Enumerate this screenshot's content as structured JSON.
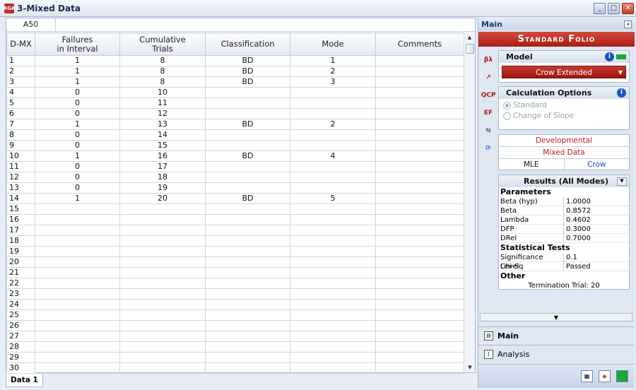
{
  "window": {
    "title": "3-Mixed Data"
  },
  "cellbar": {
    "ref": "A50"
  },
  "sheet": {
    "columns": [
      "D-MX",
      "Failures\nin Interval",
      "Cumulative\nTrials",
      "Classification",
      "Mode",
      "Comments"
    ],
    "rows": [
      [
        "1",
        "1",
        "8",
        "BD",
        "1",
        ""
      ],
      [
        "2",
        "1",
        "8",
        "BD",
        "2",
        ""
      ],
      [
        "3",
        "1",
        "8",
        "BD",
        "3",
        ""
      ],
      [
        "4",
        "0",
        "10",
        "",
        "",
        ""
      ],
      [
        "5",
        "0",
        "11",
        "",
        "",
        ""
      ],
      [
        "6",
        "0",
        "12",
        "",
        "",
        ""
      ],
      [
        "7",
        "1",
        "13",
        "BD",
        "2",
        ""
      ],
      [
        "8",
        "0",
        "14",
        "",
        "",
        ""
      ],
      [
        "9",
        "0",
        "15",
        "",
        "",
        ""
      ],
      [
        "10",
        "1",
        "16",
        "BD",
        "4",
        ""
      ],
      [
        "11",
        "0",
        "17",
        "",
        "",
        ""
      ],
      [
        "12",
        "0",
        "18",
        "",
        "",
        ""
      ],
      [
        "13",
        "0",
        "19",
        "",
        "",
        ""
      ],
      [
        "14",
        "1",
        "20",
        "BD",
        "5",
        ""
      ],
      [
        "15",
        "",
        "",
        "",
        "",
        ""
      ],
      [
        "16",
        "",
        "",
        "",
        "",
        ""
      ],
      [
        "17",
        "",
        "",
        "",
        "",
        ""
      ],
      [
        "18",
        "",
        "",
        "",
        "",
        ""
      ],
      [
        "19",
        "",
        "",
        "",
        "",
        ""
      ],
      [
        "20",
        "",
        "",
        "",
        "",
        ""
      ],
      [
        "21",
        "",
        "",
        "",
        "",
        ""
      ],
      [
        "22",
        "",
        "",
        "",
        "",
        ""
      ],
      [
        "23",
        "",
        "",
        "",
        "",
        ""
      ],
      [
        "24",
        "",
        "",
        "",
        "",
        ""
      ],
      [
        "25",
        "",
        "",
        "",
        "",
        ""
      ],
      [
        "26",
        "",
        "",
        "",
        "",
        ""
      ],
      [
        "27",
        "",
        "",
        "",
        "",
        ""
      ],
      [
        "28",
        "",
        "",
        "",
        "",
        ""
      ],
      [
        "29",
        "",
        "",
        "",
        "",
        ""
      ],
      [
        "30",
        "",
        "",
        "",
        "",
        ""
      ]
    ]
  },
  "tabs": {
    "sheet_tab": "Data 1"
  },
  "panel": {
    "header": "Main",
    "folio_title": "Standard Folio",
    "model": {
      "label": "Model",
      "selected": "Crow Extended"
    },
    "calc": {
      "label": "Calculation Options",
      "opt1": "Standard",
      "opt2": "Change of Slope"
    },
    "info": {
      "line1": "Developmental",
      "line2": "Mixed Data",
      "method": "MLE",
      "model": "Crow"
    },
    "results": {
      "header": "Results (All Modes)",
      "params_label": "Parameters",
      "params": [
        [
          "Beta (hyp)",
          "1.0000"
        ],
        [
          "Beta",
          "0.8572"
        ],
        [
          "Lambda",
          "0.4602"
        ],
        [
          "DFP",
          "0.3000"
        ],
        [
          "DRel",
          "0.7000"
        ]
      ],
      "tests_label": "Statistical Tests",
      "tests": [
        [
          "Significance Level",
          "0.1"
        ],
        [
          "Chi-Sq",
          "Passed"
        ]
      ],
      "other_label": "Other",
      "termination": "Termination Trial: 20"
    },
    "nav": {
      "main": "Main",
      "analysis": "Analysis"
    }
  }
}
